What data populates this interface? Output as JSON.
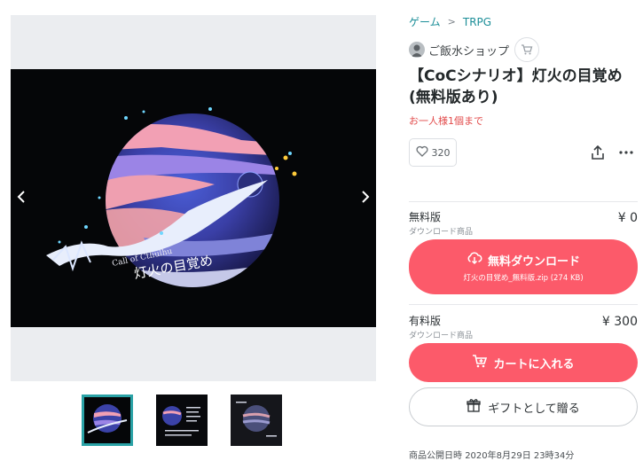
{
  "gallery": {
    "main_image_title": "Call of Cthulhu",
    "main_image_subtitle": "灯火の目覚め",
    "prev_icon": "chevron-left-icon",
    "next_icon": "chevron-right-icon",
    "thumbnails": [
      "thumbnail-1",
      "thumbnail-2",
      "thumbnail-3"
    ]
  },
  "breadcrumb": {
    "category": "ゲーム",
    "separator": ">",
    "subcategory": "TRPG"
  },
  "shop": {
    "name": "ご飯水ショップ",
    "cart_icon": "cart-icon"
  },
  "product": {
    "title": "【CoCシナリオ】灯火の目覚め(無料版あり)",
    "limit_text": "お一人様1個まで",
    "like_count": "320"
  },
  "variants": [
    {
      "name": "無料版",
      "type": "ダウンロード商品",
      "price": "¥ 0",
      "button_label": "無料ダウンロード",
      "button_sub": "灯火の目覚め_無料版.zip (274 KB)"
    },
    {
      "name": "有料版",
      "type": "ダウンロード商品",
      "price": "¥ 300",
      "button_label": "カートに入れる"
    }
  ],
  "gift_label": "ギフトとして贈る",
  "publish": {
    "label": "商品公開日時",
    "value": "2020年8月29日 23時34分"
  },
  "colors": {
    "accent": "#fc5a6a",
    "link": "#1c8e98",
    "warning": "#e24a4a",
    "thumb_border": "#2aa2a6"
  }
}
